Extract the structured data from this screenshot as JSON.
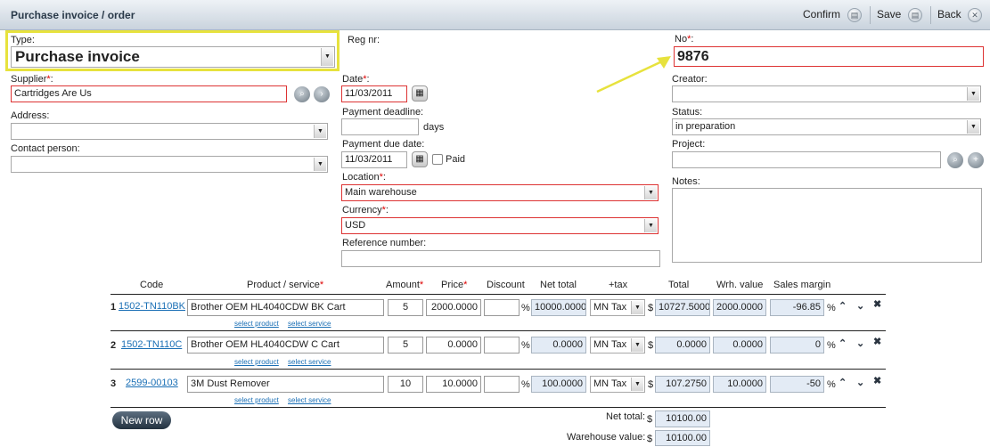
{
  "window": {
    "title": "Purchase invoice / order",
    "confirm_label": "Confirm",
    "save_label": "Save",
    "back_label": "Back"
  },
  "form": {
    "type_label": "Type:",
    "type_value": "Purchase invoice",
    "regnr_label": "Reg nr:",
    "no_label": "No",
    "no_value": "9876",
    "supplier_label": "Supplier",
    "supplier_value": "Cartridges Are Us",
    "address_label": "Address:",
    "contact_label": "Contact person:",
    "date_label": "Date",
    "date_value": "11/03/2011",
    "payment_deadline_label": "Payment deadline:",
    "days_label": "days",
    "payment_due_label": "Payment due date:",
    "payment_due_value": "11/03/2011",
    "paid_label": "Paid",
    "location_label": "Location",
    "location_value": "Main warehouse",
    "currency_label": "Currency",
    "currency_value": "USD",
    "reference_label": "Reference number:",
    "creator_label": "Creator:",
    "status_label": "Status:",
    "status_value": "in preparation",
    "project_label": "Project:",
    "notes_label": "Notes:"
  },
  "table": {
    "headers": {
      "code": "Code",
      "product": "Product / service",
      "amount": "Amount",
      "price": "Price",
      "discount": "Discount",
      "net_total": "Net total",
      "tax": "+tax",
      "total": "Total",
      "wrh_value": "Wrh. value",
      "sales_margin": "Sales margin"
    },
    "rows": [
      {
        "num": "1",
        "code": "1502-TN110BK",
        "product": "Brother OEM HL4040CDW BK Cart",
        "amount": "5",
        "price": "2000.0000",
        "discount": "",
        "net_total": "10000.0000",
        "tax": "MN Tax",
        "total": "10727.5000",
        "wrh_value": "2000.0000",
        "margin": "-96.85"
      },
      {
        "num": "2",
        "code": "1502-TN110C",
        "product": "Brother OEM HL4040CDW C Cart",
        "amount": "5",
        "price": "0.0000",
        "discount": "",
        "net_total": "0.0000",
        "tax": "MN Tax",
        "total": "0.0000",
        "wrh_value": "0.0000",
        "margin": "0"
      },
      {
        "num": "3",
        "code": "2599-00103",
        "product": "3M Dust Remover",
        "amount": "10",
        "price": "10.0000",
        "discount": "",
        "net_total": "100.0000",
        "tax": "MN Tax",
        "total": "107.2750",
        "wrh_value": "10.0000",
        "margin": "-50"
      }
    ],
    "select_product": "select product",
    "select_service": "select service",
    "percent": "%",
    "dollar": "$",
    "new_row": "New row",
    "net_total_label": "Net total:",
    "net_total_value": "10100.00",
    "warehouse_value_label": "Warehouse value:",
    "warehouse_value": "10100.00"
  },
  "colors": {
    "highlight": "#e7e23d",
    "required_border": "#dd3333",
    "link": "#1a6fb5"
  }
}
